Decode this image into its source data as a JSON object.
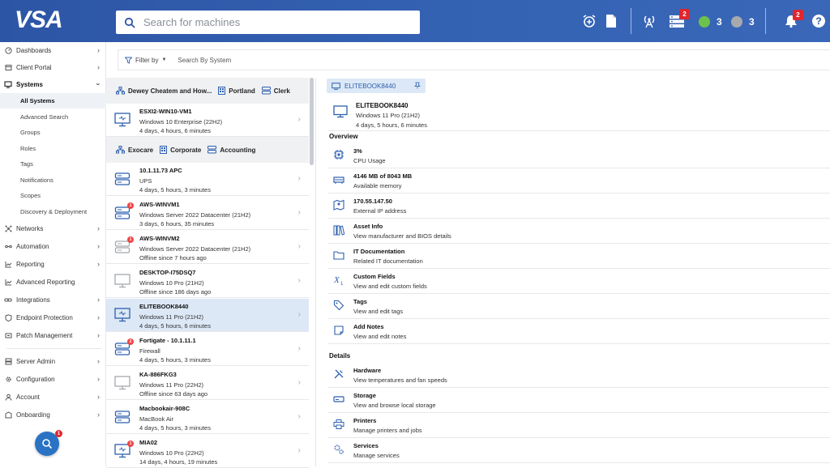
{
  "app": {
    "logo": "VSA"
  },
  "search": {
    "placeholder": "Search for machines"
  },
  "topbar": {
    "servers_badge": "2",
    "online_count": "3",
    "offline_count": "3",
    "notifications_badge": "2",
    "colors": {
      "online": "#6cc24a",
      "offline": "#a7a9ad",
      "badge": "#e0262e"
    }
  },
  "sidebar": {
    "items": [
      {
        "label": "Dashboards",
        "icon": "speedometer-icon"
      },
      {
        "label": "Client Portal",
        "icon": "portal-icon"
      },
      {
        "label": "Systems",
        "icon": "monitor-icon"
      }
    ],
    "systems_sub": [
      "All Systems",
      "Advanced Search",
      "Groups",
      "Roles",
      "Tags",
      "Notifications",
      "Scopes",
      "Discovery & Deployment"
    ],
    "items2": [
      {
        "label": "Networks",
        "icon": "network-icon"
      },
      {
        "label": "Automation",
        "icon": "automation-icon"
      },
      {
        "label": "Reporting",
        "icon": "chart-icon"
      },
      {
        "label": "Advanced Reporting",
        "icon": "chart-icon"
      },
      {
        "label": "Integrations",
        "icon": "link-icon"
      },
      {
        "label": "Endpoint Protection",
        "icon": "shield-icon"
      },
      {
        "label": "Patch Management",
        "icon": "patch-icon"
      }
    ],
    "items3": [
      {
        "label": "Server Admin",
        "icon": "server-icon"
      },
      {
        "label": "Configuration",
        "icon": "gear-icon"
      },
      {
        "label": "Account",
        "icon": "user-icon"
      },
      {
        "label": "Onboarding",
        "icon": "onboarding-icon"
      }
    ],
    "fab_badge": "1"
  },
  "filter": {
    "label": "Filter by",
    "system": "Search By System"
  },
  "groups": [
    {
      "org": "Dewey Cheatem and How...",
      "site": "Portland",
      "group": "Clerk"
    },
    {
      "org": "Exocare",
      "site": "Corporate",
      "group": "Accounting"
    }
  ],
  "machines": [
    {
      "name": "ESXI2-WIN10-VM1",
      "os": "Windows 10 Enterprise (22H2)",
      "status": "4 days, 4 hours, 6 minutes",
      "type": "monitor",
      "badge": ""
    },
    {
      "name": "10.1.11.73 APC",
      "os": "UPS",
      "status": "4 days, 5 hours, 3 minutes",
      "type": "server",
      "badge": ""
    },
    {
      "name": "AWS-WINVM1",
      "os": "Windows Server 2022 Datacenter (21H2)",
      "status": "3 days, 6 hours, 35 minutes",
      "type": "server",
      "badge": "1"
    },
    {
      "name": "AWS-WINVM2",
      "os": "Windows Server 2022 Datacenter (21H2)",
      "status": "Offline since 7 hours ago",
      "type": "server-off",
      "badge": "1"
    },
    {
      "name": "DESKTOP-I75DSQ7",
      "os": "Windows 10 Pro (21H2)",
      "status": "Offline since 186 days ago",
      "type": "monitor-off",
      "badge": ""
    },
    {
      "name": "ELITEBOOK8440",
      "os": "Windows 11 Pro (21H2)",
      "status": "4 days, 5 hours, 6 minutes",
      "type": "monitor",
      "badge": ""
    },
    {
      "name": "Fortigate -  10.1.11.1",
      "os": "Firewall",
      "status": "4 days, 5 hours, 3 minutes",
      "type": "server",
      "badge": "2"
    },
    {
      "name": "KA-886FKG3",
      "os": "Windows 11 Pro (22H2)",
      "status": "Offline since 63 days ago",
      "type": "monitor-off",
      "badge": ""
    },
    {
      "name": "Macbookair-908C",
      "os": "MacBook Air",
      "status": "4 days, 5 hours, 3 minutes",
      "type": "server",
      "badge": ""
    },
    {
      "name": "MIA02",
      "os": "Windows 10 Pro (22H2)",
      "status": "14 days, 4 hours, 19 minutes",
      "type": "monitor",
      "badge": "1"
    }
  ],
  "detail": {
    "pill": "ELITEBOOK8440",
    "name": "ELITEBOOK8440",
    "os": "Windows 11 Pro (21H2)",
    "uptime": "4 days, 5 hours, 6 minutes",
    "overview_title": "Overview",
    "overview": [
      {
        "title": "3%",
        "sub": "CPU Usage",
        "icon": "cpu-icon"
      },
      {
        "title": "4146 MB of 8043 MB",
        "sub": "Available memory",
        "icon": "memory-icon"
      },
      {
        "title": "170.55.147.50",
        "sub": "External IP address",
        "icon": "map-icon"
      },
      {
        "title": "Asset Info",
        "sub": "View manufacturer and BIOS details",
        "icon": "books-icon"
      },
      {
        "title": "IT Documentation",
        "sub": "Related IT documentation",
        "icon": "folder-icon"
      },
      {
        "title": "Custom Fields",
        "sub": "View and edit custom fields",
        "icon": "variable-icon"
      },
      {
        "title": "Tags",
        "sub": "View and edit tags",
        "icon": "tag-icon"
      },
      {
        "title": "Add Notes",
        "sub": "View and edit notes",
        "icon": "note-icon"
      }
    ],
    "details_title": "Details",
    "details": [
      {
        "title": "Hardware",
        "sub": "View temperatures and fan speeds",
        "icon": "tools-icon"
      },
      {
        "title": "Storage",
        "sub": "View and browse local storage",
        "icon": "storage-icon"
      },
      {
        "title": "Printers",
        "sub": "Manage printers and jobs",
        "icon": "printer-icon"
      },
      {
        "title": "Services",
        "sub": "Manage services",
        "icon": "gears-icon"
      }
    ]
  }
}
